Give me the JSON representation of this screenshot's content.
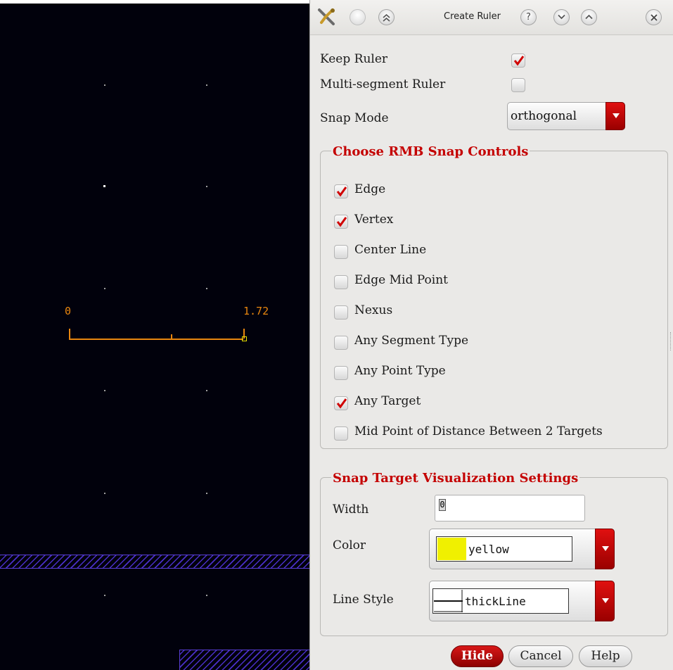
{
  "canvas": {
    "ruler": {
      "start_label": "0",
      "end_label": "1.72"
    }
  },
  "dialog": {
    "title": "Create Ruler",
    "titlebar_icons": [
      "app-tools-icon",
      "minimize-icon",
      "shade-icon",
      "help-icon",
      "chevron-down-icon",
      "chevron-up-icon",
      "close-icon"
    ],
    "keep_ruler": {
      "label": "Keep Ruler",
      "checked": true
    },
    "multi_segment": {
      "label": "Multi-segment Ruler",
      "checked": false
    },
    "snap_mode": {
      "label": "Snap Mode",
      "value": "orthogonal"
    },
    "rmb_group": {
      "title": "Choose RMB Snap Controls",
      "items": [
        {
          "label": "Edge",
          "checked": true
        },
        {
          "label": "Vertex",
          "checked": true
        },
        {
          "label": "Center Line",
          "checked": false
        },
        {
          "label": "Edge Mid Point",
          "checked": false
        },
        {
          "label": "Nexus",
          "checked": false
        },
        {
          "label": "Any Segment Type",
          "checked": false
        },
        {
          "label": "Any Point Type",
          "checked": false
        },
        {
          "label": "Any Target",
          "checked": true
        },
        {
          "label": "Mid Point of Distance Between 2 Targets",
          "checked": false
        }
      ]
    },
    "vis_group": {
      "title": "Snap Target Visualization Settings",
      "width": {
        "label": "Width",
        "value": "0"
      },
      "color": {
        "label": "Color",
        "value": "yellow",
        "swatch": "#f0f000"
      },
      "line_style": {
        "label": "Line Style",
        "value": "thickLine"
      }
    },
    "buttons": {
      "hide": "Hide",
      "cancel": "Cancel",
      "help": "Help"
    }
  },
  "colors": {
    "accent": "#c40000",
    "ruler": "#e8860f",
    "canvas_bg": "#01010c",
    "hatch": "#4a2fc8"
  }
}
